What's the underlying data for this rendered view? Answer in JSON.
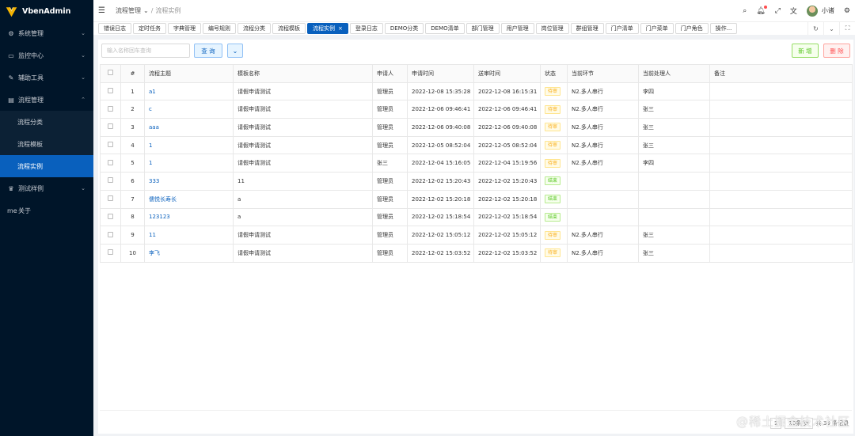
{
  "app": {
    "name": "VbenAdmin"
  },
  "sidebar": {
    "items": [
      {
        "label": "系统管理",
        "icon": "gear-icon",
        "glyph": "⚙",
        "arrow": "⌄"
      },
      {
        "label": "监控中心",
        "icon": "monitor-icon",
        "glyph": "▭",
        "arrow": "⌄"
      },
      {
        "label": "辅助工具",
        "icon": "tool-icon",
        "glyph": "✎",
        "arrow": "⌄"
      },
      {
        "label": "流程管理",
        "icon": "flow-icon",
        "glyph": "▤",
        "arrow": "⌃"
      }
    ],
    "sub_items": [
      {
        "label": "流程分类",
        "active": false
      },
      {
        "label": "流程模板",
        "active": false
      },
      {
        "label": "流程实例",
        "active": true
      }
    ],
    "after_items": [
      {
        "label": "测试样例",
        "icon": "trophy-icon",
        "glyph": "♛",
        "arrow": "⌄"
      },
      {
        "label": "关于",
        "icon": "about-icon",
        "glyph": "me",
        "arrow": ""
      }
    ]
  },
  "header": {
    "breadcrumb": [
      "流程管理",
      "流程实例"
    ],
    "breadcrumb_sep": "/",
    "breadcrumb_chevron": "⌄",
    "user_name": "小诸"
  },
  "tabs": [
    {
      "label": "错误日志",
      "active": false
    },
    {
      "label": "定时任务",
      "active": false
    },
    {
      "label": "字典管理",
      "active": false
    },
    {
      "label": "编号规则",
      "active": false
    },
    {
      "label": "流程分类",
      "active": false
    },
    {
      "label": "流程模板",
      "active": false
    },
    {
      "label": "流程实例",
      "active": true
    },
    {
      "label": "登录日志",
      "active": false
    },
    {
      "label": "DEMO分类",
      "active": false
    },
    {
      "label": "DEMO清单",
      "active": false
    },
    {
      "label": "部门管理",
      "active": false
    },
    {
      "label": "用户管理",
      "active": false
    },
    {
      "label": "岗位管理",
      "active": false
    },
    {
      "label": "群组管理",
      "active": false
    },
    {
      "label": "门户清单",
      "active": false
    },
    {
      "label": "门户菜单",
      "active": false
    },
    {
      "label": "门户角色",
      "active": false
    },
    {
      "label": "操作...",
      "active": false
    }
  ],
  "toolbar": {
    "search_placeholder": "输入名称回车查询",
    "query_label": "查 询",
    "add_label": "新 增",
    "delete_label": "删 除"
  },
  "table": {
    "columns": [
      "#",
      "流程主题",
      "模板名称",
      "申请人",
      "申请时间",
      "送审时间",
      "状态",
      "当前环节",
      "当前处理人",
      "备注"
    ],
    "rows": [
      [
        "1",
        "a1",
        "请假申请测试",
        "管理员",
        "2022-12-08 15:35:28",
        "2022-12-08 16:15:31",
        "待审",
        "N2.多人串行",
        "李四",
        ""
      ],
      [
        "2",
        "c",
        "请假申请测试",
        "管理员",
        "2022-12-06 09:46:41",
        "2022-12-06 09:46:41",
        "待审",
        "N2.多人串行",
        "张三",
        ""
      ],
      [
        "3",
        "aaa",
        "请假申请测试",
        "管理员",
        "2022-12-06 09:40:08",
        "2022-12-06 09:40:08",
        "待审",
        "N2.多人串行",
        "张三",
        ""
      ],
      [
        "4",
        "1",
        "请假申请测试",
        "管理员",
        "2022-12-05 08:52:04",
        "2022-12-05 08:52:04",
        "待审",
        "N2.多人串行",
        "张三",
        ""
      ],
      [
        "5",
        "1",
        "请假申请测试",
        "张三",
        "2022-12-04 15:16:05",
        "2022-12-04 15:19:56",
        "待审",
        "N2.多人串行",
        "李四",
        ""
      ],
      [
        "6",
        "333",
        "11",
        "管理员",
        "2022-12-02 15:20:43",
        "2022-12-02 15:20:43",
        "结束",
        "",
        "",
        ""
      ],
      [
        "7",
        "儒悦长寿长",
        "a",
        "管理员",
        "2022-12-02 15:20:18",
        "2022-12-02 15:20:18",
        "结束",
        "",
        "",
        ""
      ],
      [
        "8",
        "123123",
        "a",
        "管理员",
        "2022-12-02 15:18:54",
        "2022-12-02 15:18:54",
        "结束",
        "",
        "",
        ""
      ],
      [
        "9",
        "11",
        "请假申请测试",
        "管理员",
        "2022-12-02 15:05:12",
        "2022-12-02 15:05:12",
        "待审",
        "N2.多人串行",
        "张三",
        ""
      ],
      [
        "10",
        "李飞",
        "请假申请测试",
        "管理员",
        "2022-12-02 15:03:52",
        "2022-12-02 15:03:52",
        "待审",
        "N2.多人串行",
        "张三",
        ""
      ]
    ]
  },
  "pager": {
    "current": "1",
    "size": "10条/页",
    "total": "共 39 条记录"
  },
  "watermark": "@稀土掘金技术社区",
  "colors": {
    "sidebar_bg": "#001529",
    "primary": "#0960bd",
    "success": "#52c41a",
    "warning": "#faad14",
    "danger": "#ff4d4f"
  }
}
